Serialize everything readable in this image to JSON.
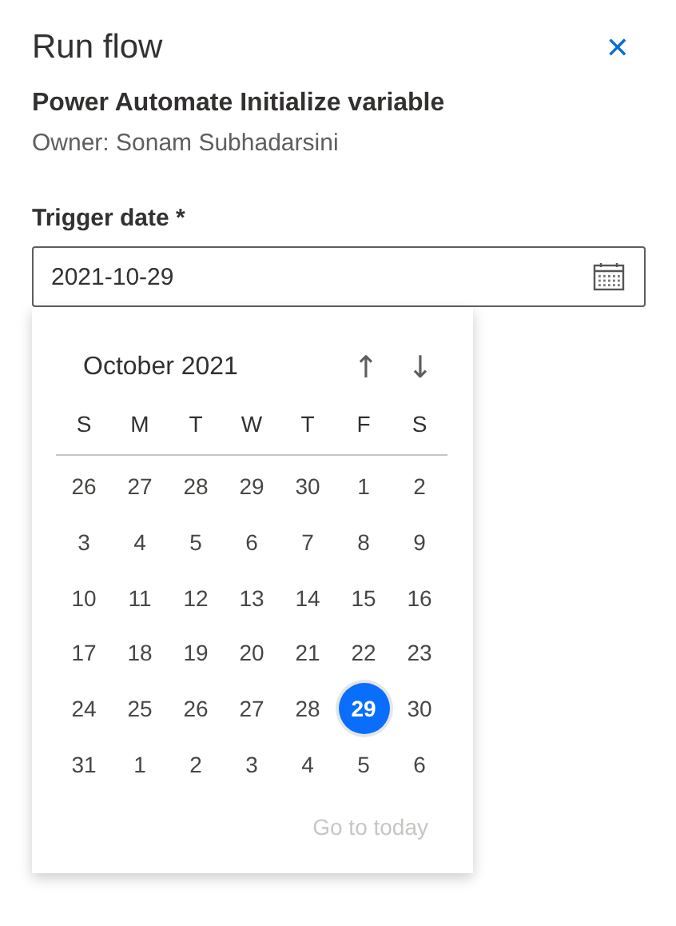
{
  "panel": {
    "title": "Run flow",
    "close_icon": "✕",
    "flow_name": "Power Automate Initialize variable",
    "owner": "Owner: Sonam Subhadarsini"
  },
  "field": {
    "label": "Trigger date *",
    "value": "2021-10-29"
  },
  "calendar": {
    "month": "October 2021",
    "prev_icon": "↑",
    "next_icon": "↓",
    "weekdays": [
      "S",
      "M",
      "T",
      "W",
      "T",
      "F",
      "S"
    ],
    "weeks": [
      [
        {
          "day": "26",
          "selected": false
        },
        {
          "day": "27",
          "selected": false
        },
        {
          "day": "28",
          "selected": false
        },
        {
          "day": "29",
          "selected": false
        },
        {
          "day": "30",
          "selected": false
        },
        {
          "day": "1",
          "selected": false
        },
        {
          "day": "2",
          "selected": false
        }
      ],
      [
        {
          "day": "3",
          "selected": false
        },
        {
          "day": "4",
          "selected": false
        },
        {
          "day": "5",
          "selected": false
        },
        {
          "day": "6",
          "selected": false
        },
        {
          "day": "7",
          "selected": false
        },
        {
          "day": "8",
          "selected": false
        },
        {
          "day": "9",
          "selected": false
        }
      ],
      [
        {
          "day": "10",
          "selected": false
        },
        {
          "day": "11",
          "selected": false
        },
        {
          "day": "12",
          "selected": false
        },
        {
          "day": "13",
          "selected": false
        },
        {
          "day": "14",
          "selected": false
        },
        {
          "day": "15",
          "selected": false
        },
        {
          "day": "16",
          "selected": false
        }
      ],
      [
        {
          "day": "17",
          "selected": false
        },
        {
          "day": "18",
          "selected": false
        },
        {
          "day": "19",
          "selected": false
        },
        {
          "day": "20",
          "selected": false
        },
        {
          "day": "21",
          "selected": false
        },
        {
          "day": "22",
          "selected": false
        },
        {
          "day": "23",
          "selected": false
        }
      ],
      [
        {
          "day": "24",
          "selected": false
        },
        {
          "day": "25",
          "selected": false
        },
        {
          "day": "26",
          "selected": false
        },
        {
          "day": "27",
          "selected": false
        },
        {
          "day": "28",
          "selected": false
        },
        {
          "day": "29",
          "selected": true
        },
        {
          "day": "30",
          "selected": false
        }
      ],
      [
        {
          "day": "31",
          "selected": false
        },
        {
          "day": "1",
          "selected": false
        },
        {
          "day": "2",
          "selected": false
        },
        {
          "day": "3",
          "selected": false
        },
        {
          "day": "4",
          "selected": false
        },
        {
          "day": "5",
          "selected": false
        },
        {
          "day": "6",
          "selected": false
        }
      ]
    ],
    "go_to_today": {
      "label": "Go to today",
      "disabled": true
    }
  }
}
